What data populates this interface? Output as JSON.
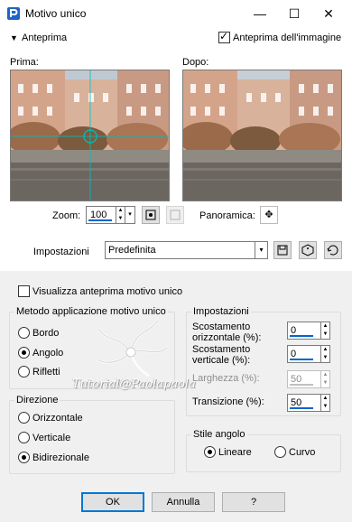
{
  "window": {
    "title": "Motivo unico",
    "minimize_icon": "—",
    "maximize_icon": "☐",
    "close_icon": "✕"
  },
  "preview": {
    "toggle_label": "Anteprima",
    "toggle_arrow": "▼",
    "image_preview_label": "Anteprima dell'immagine",
    "image_preview_checked": true,
    "before_label": "Prima:",
    "after_label": "Dopo:",
    "zoom_label": "Zoom:",
    "zoom_value": "100",
    "pan_label": "Panoramica:"
  },
  "settings_bar": {
    "label": "Impostazioni",
    "preset_value": "Predefinita"
  },
  "tile_preview": {
    "label": "Visualizza anteprima motivo unico",
    "checked": false
  },
  "method": {
    "title": "Metodo applicazione motivo unico",
    "options": [
      "Bordo",
      "Angolo",
      "Rifletti"
    ],
    "selected": "Angolo"
  },
  "direction": {
    "title": "Direzione",
    "options": [
      "Orizzontale",
      "Verticale",
      "Bidirezionale"
    ],
    "selected": "Bidirezionale"
  },
  "impostazioni": {
    "title": "Impostazioni",
    "h_offset_label": "Scostamento orizzontale (%):",
    "h_offset_value": "0",
    "v_offset_label": "Scostamento verticale (%):",
    "v_offset_value": "0",
    "width_label": "Larghezza (%):",
    "width_value": "50",
    "transition_label": "Transizione (%):",
    "transition_value": "50"
  },
  "corner_style": {
    "title": "Stile angolo",
    "options": [
      "Lineare",
      "Curvo"
    ],
    "selected": "Lineare"
  },
  "watermark": {
    "text": "Tutorial@Paolapaola"
  },
  "buttons": {
    "ok": "OK",
    "cancel": "Annulla",
    "help": "?"
  },
  "colors": {
    "accent": "#0078d7",
    "crosshair": "#00c0c0"
  }
}
